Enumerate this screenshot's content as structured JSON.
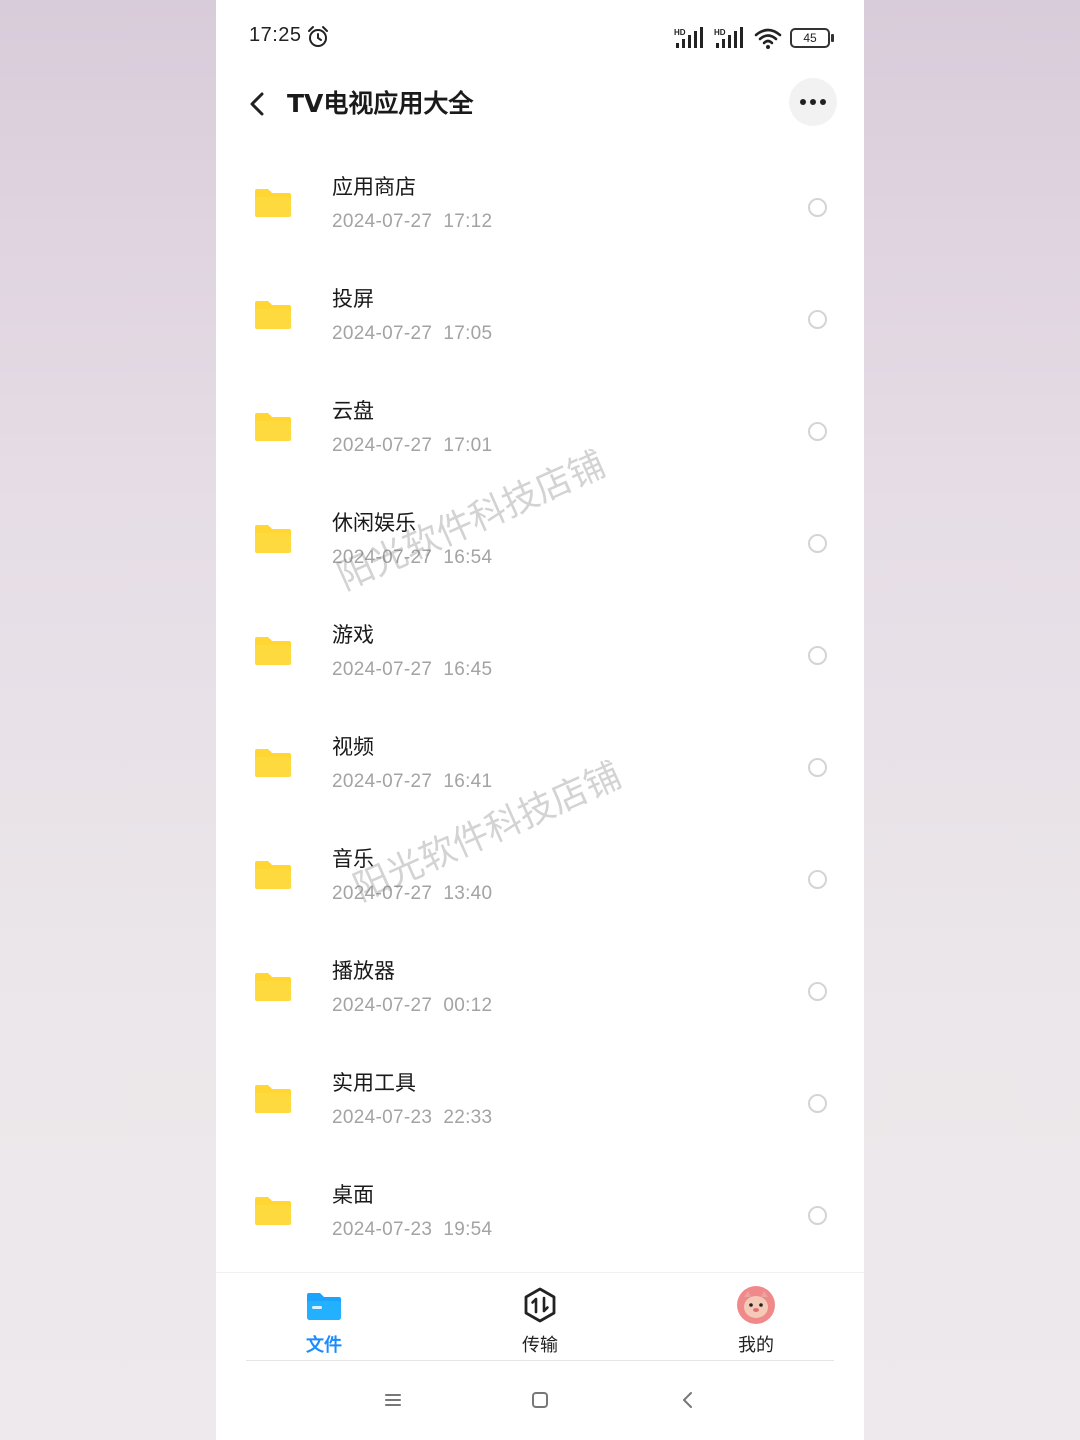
{
  "status_bar": {
    "time": "17:25",
    "signal_label_1": "HD",
    "signal_label_2": "HD",
    "battery": "45"
  },
  "header": {
    "title": "TV电视应用大全"
  },
  "files": [
    {
      "name": "应用商店",
      "date": "2024-07-27  17:12"
    },
    {
      "name": "投屏",
      "date": "2024-07-27  17:05"
    },
    {
      "name": "云盘",
      "date": "2024-07-27  17:01"
    },
    {
      "name": "休闲娱乐",
      "date": "2024-07-27  16:54"
    },
    {
      "name": "游戏",
      "date": "2024-07-27  16:45"
    },
    {
      "name": "视频",
      "date": "2024-07-27  16:41"
    },
    {
      "name": "音乐",
      "date": "2024-07-27  13:40"
    },
    {
      "name": "播放器",
      "date": "2024-07-27  00:12"
    },
    {
      "name": "实用工具",
      "date": "2024-07-23  22:33"
    },
    {
      "name": "桌面",
      "date": "2024-07-23  19:54"
    }
  ],
  "watermarks": [
    "阳光软件科技店铺",
    "阳光软件科技店铺"
  ],
  "bottom_nav": {
    "tabs": [
      {
        "label": "文件",
        "icon": "folder-icon",
        "active": true
      },
      {
        "label": "传输",
        "icon": "transfer-icon",
        "active": false
      },
      {
        "label": "我的",
        "icon": "avatar-icon",
        "active": false
      }
    ]
  },
  "colors": {
    "accent": "#1a8cff",
    "folder": "#ffd633",
    "text_primary": "#1a1a1a",
    "text_secondary": "#a3a3a3"
  }
}
